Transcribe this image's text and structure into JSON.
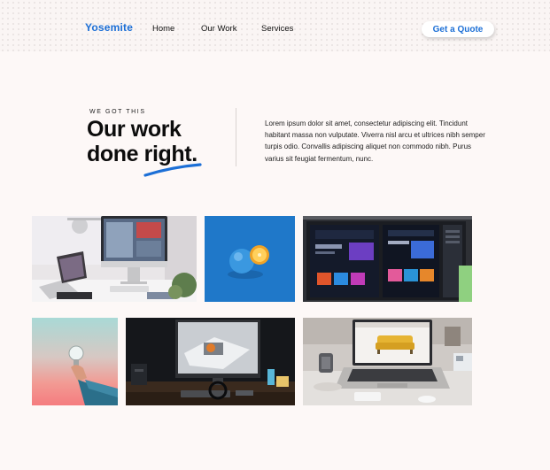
{
  "header": {
    "logo": "Yosemite",
    "nav": {
      "home": "Home",
      "our_work": "Our Work",
      "services": "Services"
    },
    "cta_label": "Get a Quote"
  },
  "hero": {
    "eyebrow": "WE GOT THIS",
    "headline_line1": "Our work",
    "headline_line2_start": "done ",
    "headline_line2_highlight": "right.",
    "description": "Lorem ipsum dolor sit amet, consectetur adipiscing elit. Tincidunt habitant massa non vulputate. Viverra nisl arcu et ultrices nibh semper turpis odio. Convallis adipiscing aliquet non commodo nibh. Purus varius sit feugiat fermentum, nunc."
  },
  "colors": {
    "accent": "#1c6fd6",
    "background": "#fdf8f7"
  },
  "gallery": [
    {
      "name": "desk-with-imac-and-laptop-photo"
    },
    {
      "name": "blue-orange-on-blue-photo"
    },
    {
      "name": "monitor-showing-web-designs-photo"
    },
    {
      "name": "hand-holding-lightbulb-photo"
    },
    {
      "name": "dark-desk-monitor-photo"
    },
    {
      "name": "laptop-showing-sofa-website-photo"
    }
  ]
}
